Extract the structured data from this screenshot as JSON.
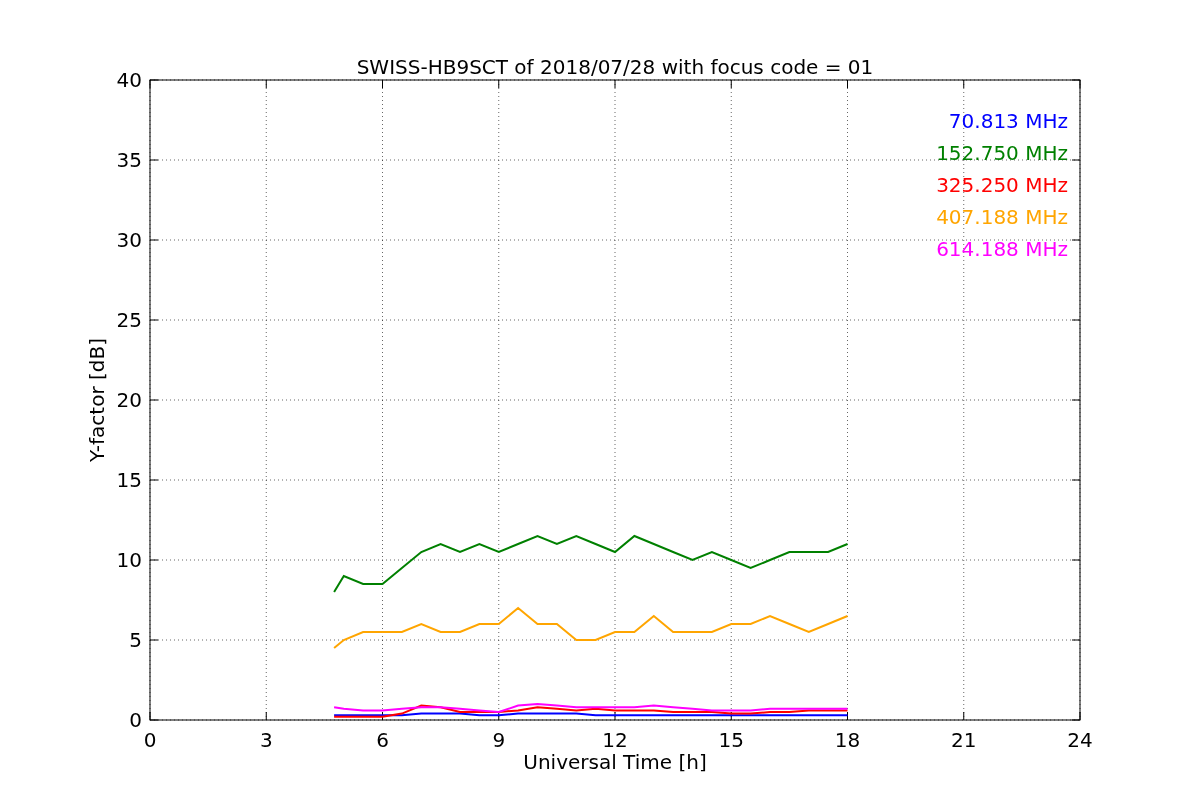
{
  "chart_data": {
    "type": "line",
    "title": "SWISS-HB9SCT of 2018/07/28 with focus code = 01",
    "xlabel": "Universal Time [h]",
    "ylabel": "Y-factor [dB]",
    "x": [
      4.75,
      5,
      5.5,
      6,
      6.5,
      7,
      7.5,
      8,
      8.5,
      9,
      9.5,
      10,
      10.5,
      11,
      11.5,
      12,
      12.5,
      13,
      13.5,
      14,
      14.5,
      15,
      15.5,
      16,
      16.5,
      17,
      17.5,
      18
    ],
    "series": [
      {
        "name": "70.813 MHz",
        "color": "#0000ff",
        "values": [
          0.3,
          0.3,
          0.3,
          0.3,
          0.3,
          0.4,
          0.4,
          0.4,
          0.3,
          0.3,
          0.4,
          0.4,
          0.4,
          0.4,
          0.3,
          0.3,
          0.3,
          0.3,
          0.3,
          0.3,
          0.3,
          0.3,
          0.3,
          0.3,
          0.3,
          0.3,
          0.3,
          0.3
        ]
      },
      {
        "name": "152.750 MHz",
        "color": "#008000",
        "values": [
          8,
          9,
          8.5,
          8.5,
          9.5,
          10.5,
          11,
          10.5,
          11,
          10.5,
          11,
          11.5,
          11,
          11.5,
          11,
          10.5,
          11.5,
          11,
          10.5,
          10,
          10.5,
          10,
          9.5,
          10,
          10.5,
          10.5,
          10.5,
          11
        ]
      },
      {
        "name": "325.250 MHz",
        "color": "#ff0000",
        "values": [
          0.2,
          0.2,
          0.2,
          0.2,
          0.4,
          0.9,
          0.8,
          0.5,
          0.5,
          0.5,
          0.6,
          0.8,
          0.7,
          0.6,
          0.7,
          0.6,
          0.6,
          0.6,
          0.5,
          0.5,
          0.5,
          0.4,
          0.4,
          0.5,
          0.5,
          0.6,
          0.6,
          0.6
        ]
      },
      {
        "name": "407.188 MHz",
        "color": "#ffa500",
        "values": [
          4.5,
          5,
          5.5,
          5.5,
          5.5,
          6,
          5.5,
          5.5,
          6,
          6,
          7,
          6,
          6,
          5,
          5,
          5.5,
          5.5,
          6.5,
          5.5,
          5.5,
          5.5,
          6,
          6,
          6.5,
          6,
          5.5,
          6,
          6.5
        ]
      },
      {
        "name": "614.188 MHz",
        "color": "#ff00ff",
        "values": [
          0.8,
          0.7,
          0.6,
          0.6,
          0.7,
          0.8,
          0.8,
          0.7,
          0.6,
          0.5,
          0.9,
          1,
          0.9,
          0.8,
          0.8,
          0.8,
          0.8,
          0.9,
          0.8,
          0.7,
          0.6,
          0.6,
          0.6,
          0.7,
          0.7,
          0.7,
          0.7,
          0.7
        ]
      }
    ],
    "grid": true,
    "xlim": [
      0,
      24
    ],
    "ylim": [
      0,
      40
    ],
    "xticks": [
      0,
      3,
      6,
      9,
      12,
      15,
      18,
      21,
      24
    ],
    "yticks": [
      0,
      5,
      10,
      15,
      20,
      25,
      30,
      35,
      40
    ]
  }
}
